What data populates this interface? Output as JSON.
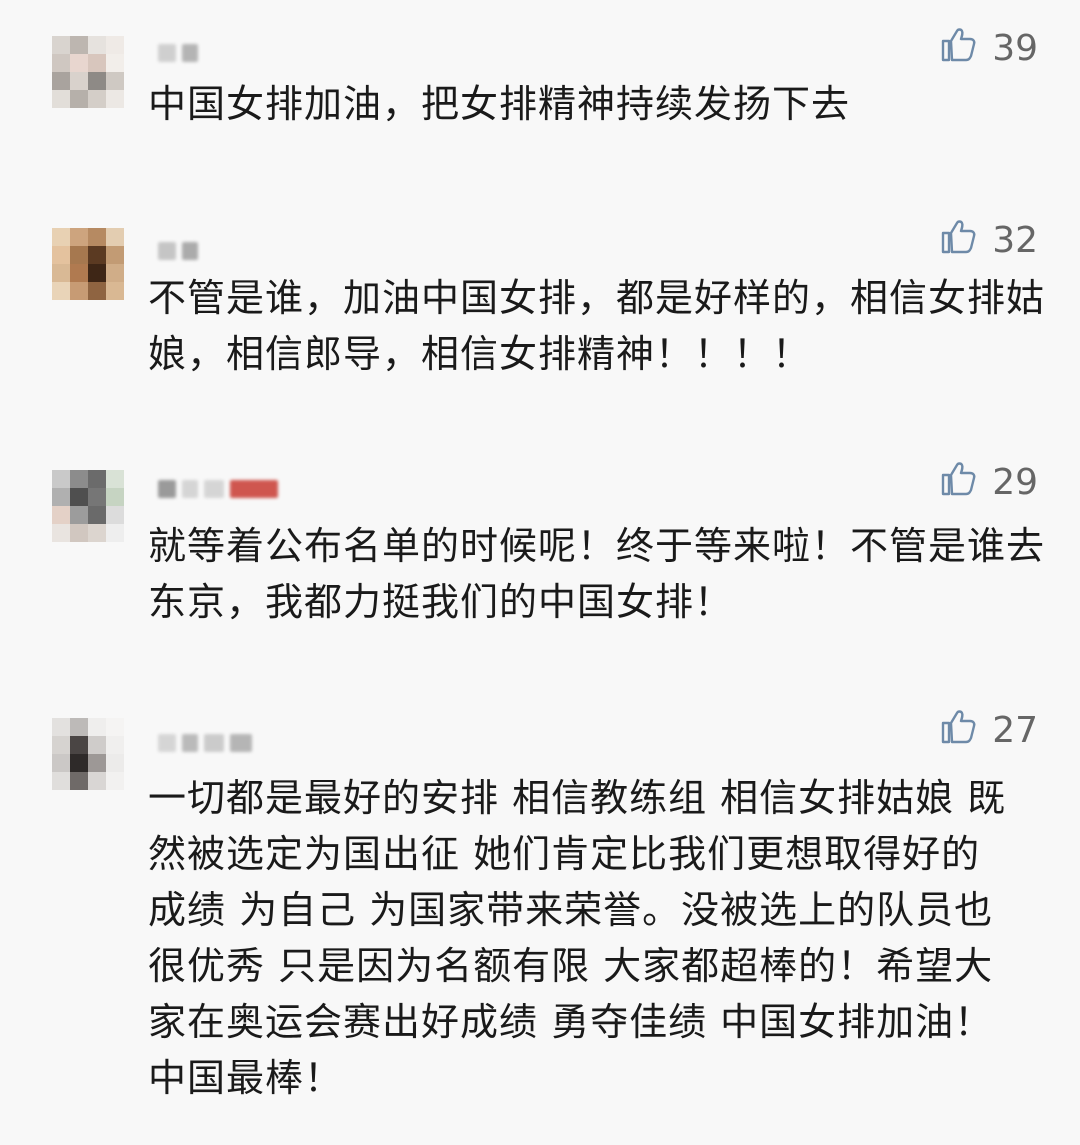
{
  "comments": [
    {
      "likes": "39",
      "text": "中国女排加油，把女排精神持续发扬下去",
      "avatar_colors": [
        "#d9d4cf",
        "#bdb6b0",
        "#e6e2de",
        "#efeae6",
        "#cfc7c1",
        "#e8d6cf",
        "#d8c6bd",
        "#f2eeea",
        "#a9a39e",
        "#d9d2cc",
        "#8e8a86",
        "#cfc9c3",
        "#e2ded9",
        "#b6b0aa",
        "#d4cec8",
        "#ece8e4"
      ],
      "name_blocks": [
        "#c9c9c9",
        "#a9a9a9"
      ]
    },
    {
      "likes": "32",
      "text": "不管是谁，加油中国女排，都是好样的，相信女排姑娘，相信郎导，相信女排精神！！！！",
      "avatar_colors": [
        "#e8d1b3",
        "#cda47e",
        "#b68a62",
        "#e3cdb1",
        "#e4c29e",
        "#a6784f",
        "#5b3a22",
        "#c29b74",
        "#d9b995",
        "#b07a50",
        "#3e2616",
        "#d0ad88",
        "#e9d4b8",
        "#c79b74",
        "#8f6441",
        "#d9b893"
      ],
      "name_blocks": [
        "#bdbdbd",
        "#9e9e9e"
      ]
    },
    {
      "likes": "29",
      "text": "就等着公布名单的时候呢！终于等来啦！不管是谁去东京，我都力挺我们的中国女排！",
      "avatar_colors": [
        "#c9c9c9",
        "#8c8c8c",
        "#6b6b6b",
        "#d9e2d6",
        "#b0b0b0",
        "#4f4f4f",
        "#767676",
        "#c6d4c2",
        "#e4d1c7",
        "#9c9c9c",
        "#6a6a6a",
        "#dcdcdc",
        "#e9e4e0",
        "#d1c7c0",
        "#dcd5cf",
        "#eeeeee"
      ],
      "name_blocks": [
        "#8a8a8a",
        "#cfcfcf",
        "#d0d0d0",
        "#c83a32"
      ]
    },
    {
      "likes": "27",
      "text": "一切都是最好的安排 相信教练组 相信女排姑娘 既然被选定为国出征 她们肯定比我们更想取得好的成绩 为自己 为国家带来荣誉。没被选上的队员也很优秀 只是因为名额有限 大家都超棒的！希望大家在奥运会赛出好成绩 勇夺佳绩 中国女排加油！中国最棒！",
      "avatar_colors": [
        "#e3e1df",
        "#bdbab8",
        "#efeeed",
        "#f5f4f3",
        "#d6d3d0",
        "#4a4544",
        "#cfccca",
        "#f0efee",
        "#cbc8c6",
        "#2e2a29",
        "#9d9896",
        "#ecebea",
        "#e0dedc",
        "#6f6a68",
        "#d9d6d4",
        "#f2f1f0"
      ],
      "name_blocks": [
        "#d0d0d0",
        "#b0b0b0",
        "#c4c4c4",
        "#aaaaaa"
      ]
    }
  ],
  "colors": {
    "like_icon": "#6e8aa8",
    "like_count": "#666666",
    "text": "#1a1a1a"
  }
}
